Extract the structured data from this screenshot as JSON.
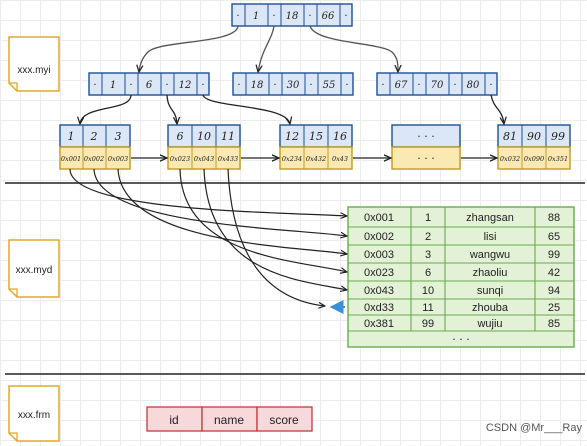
{
  "files": {
    "myi": "xxx.myi",
    "myd": "xxx.myd",
    "frm": "xxx.frm"
  },
  "btree": {
    "root": [
      "·",
      "1",
      "·",
      "18",
      "·",
      "66",
      "·"
    ],
    "level1": [
      [
        "·",
        "1",
        "·",
        "6",
        "·",
        "12",
        "·"
      ],
      [
        "·",
        "18",
        "·",
        "30",
        "·",
        "55",
        "·"
      ],
      [
        "·",
        "67",
        "·",
        "70",
        "·",
        "80",
        "·"
      ]
    ],
    "leaves": [
      {
        "keys": [
          "1",
          "2",
          "3"
        ],
        "ptrs": [
          "0x001",
          "0x002",
          "0x003"
        ]
      },
      {
        "keys": [
          "6",
          "10",
          "11"
        ],
        "ptrs": [
          "0x023",
          "0x043",
          "0x433"
        ]
      },
      {
        "keys": [
          "12",
          "15",
          "16"
        ],
        "ptrs": [
          "0x234",
          "0x432",
          "0x43"
        ]
      },
      {
        "keys": [
          "· · ·"
        ],
        "ptrs": [
          "· · ·"
        ]
      },
      {
        "keys": [
          "81",
          "90",
          "99"
        ],
        "ptrs": [
          "0x032",
          "0x090",
          "0x351"
        ]
      }
    ]
  },
  "data_table": {
    "rows": [
      [
        "0x001",
        "1",
        "zhangsan",
        "88"
      ],
      [
        "0x002",
        "2",
        "lisi",
        "65"
      ],
      [
        "0x003",
        "3",
        "wangwu",
        "99"
      ],
      [
        "0x023",
        "6",
        "zhaoliu",
        "42"
      ],
      [
        "0x043",
        "10",
        "sunqi",
        "94"
      ],
      [
        "0xd33",
        "11",
        "zhouba",
        "25"
      ],
      [
        "0x381",
        "99",
        "wujiu",
        "85"
      ]
    ],
    "ellipsis": "· · ·"
  },
  "schema": {
    "columns": [
      "id",
      "name",
      "score"
    ]
  },
  "watermark": "CSDN @Mr___Ray",
  "colors": {
    "index_fill": "#dbe7f6",
    "index_stroke": "#1e4f93",
    "ptr_fill": "#fbe9b3",
    "ptr_stroke": "#c49a1c",
    "file_stroke": "#e0a82e",
    "table_fill": "#e3f1d6",
    "table_stroke": "#6aaa4e",
    "schema_fill": "#f7d9db",
    "schema_stroke": "#c33b3b",
    "arrow": "#222222",
    "highlight": "#3a8fd6"
  }
}
